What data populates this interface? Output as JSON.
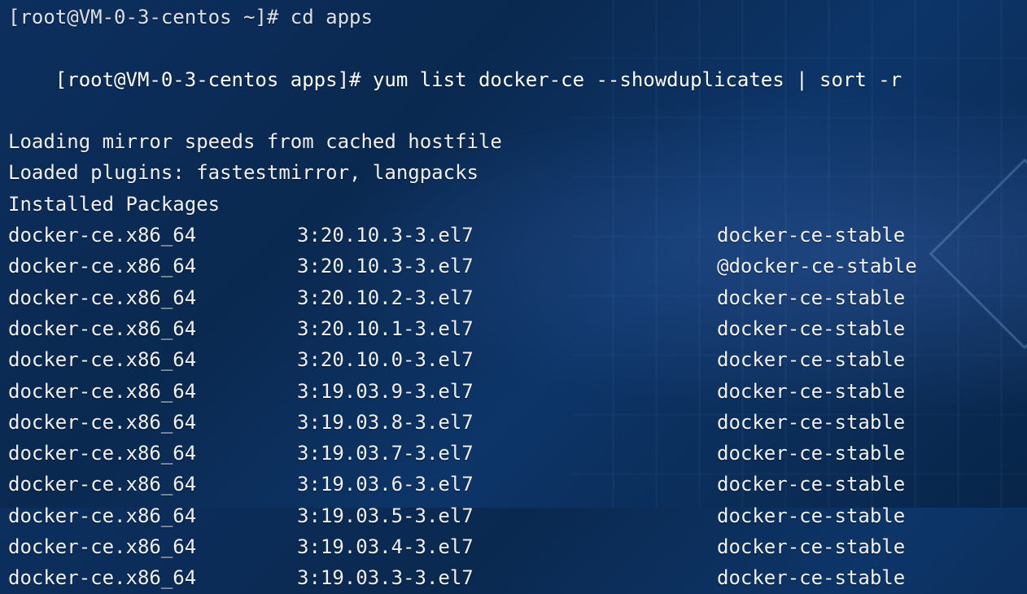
{
  "terminal": {
    "truncated_top": "[root@VM-0-3-centos ~]# cd apps",
    "prompt": "[root@VM-0-3-centos apps]# ",
    "command": "yum list docker-ce --showduplicates | sort -r",
    "lines": [
      "Loading mirror speeds from cached hostfile",
      "Loaded plugins: fastestmirror, langpacks",
      "Installed Packages"
    ],
    "packages": [
      {
        "name": "docker-ce.x86_64",
        "version": "3:20.10.3-3.el7",
        "repo": "docker-ce-stable"
      },
      {
        "name": "docker-ce.x86_64",
        "version": "3:20.10.3-3.el7",
        "repo": "@docker-ce-stable"
      },
      {
        "name": "docker-ce.x86_64",
        "version": "3:20.10.2-3.el7",
        "repo": "docker-ce-stable"
      },
      {
        "name": "docker-ce.x86_64",
        "version": "3:20.10.1-3.el7",
        "repo": "docker-ce-stable"
      },
      {
        "name": "docker-ce.x86_64",
        "version": "3:20.10.0-3.el7",
        "repo": "docker-ce-stable"
      },
      {
        "name": "docker-ce.x86_64",
        "version": "3:19.03.9-3.el7",
        "repo": "docker-ce-stable"
      },
      {
        "name": "docker-ce.x86_64",
        "version": "3:19.03.8-3.el7",
        "repo": "docker-ce-stable"
      },
      {
        "name": "docker-ce.x86_64",
        "version": "3:19.03.7-3.el7",
        "repo": "docker-ce-stable"
      },
      {
        "name": "docker-ce.x86_64",
        "version": "3:19.03.6-3.el7",
        "repo": "docker-ce-stable"
      },
      {
        "name": "docker-ce.x86_64",
        "version": "3:19.03.5-3.el7",
        "repo": "docker-ce-stable"
      },
      {
        "name": "docker-ce.x86_64",
        "version": "3:19.03.4-3.el7",
        "repo": "docker-ce-stable"
      },
      {
        "name": "docker-ce.x86_64",
        "version": "3:19.03.3-3.el7",
        "repo": "docker-ce-stable"
      }
    ]
  }
}
